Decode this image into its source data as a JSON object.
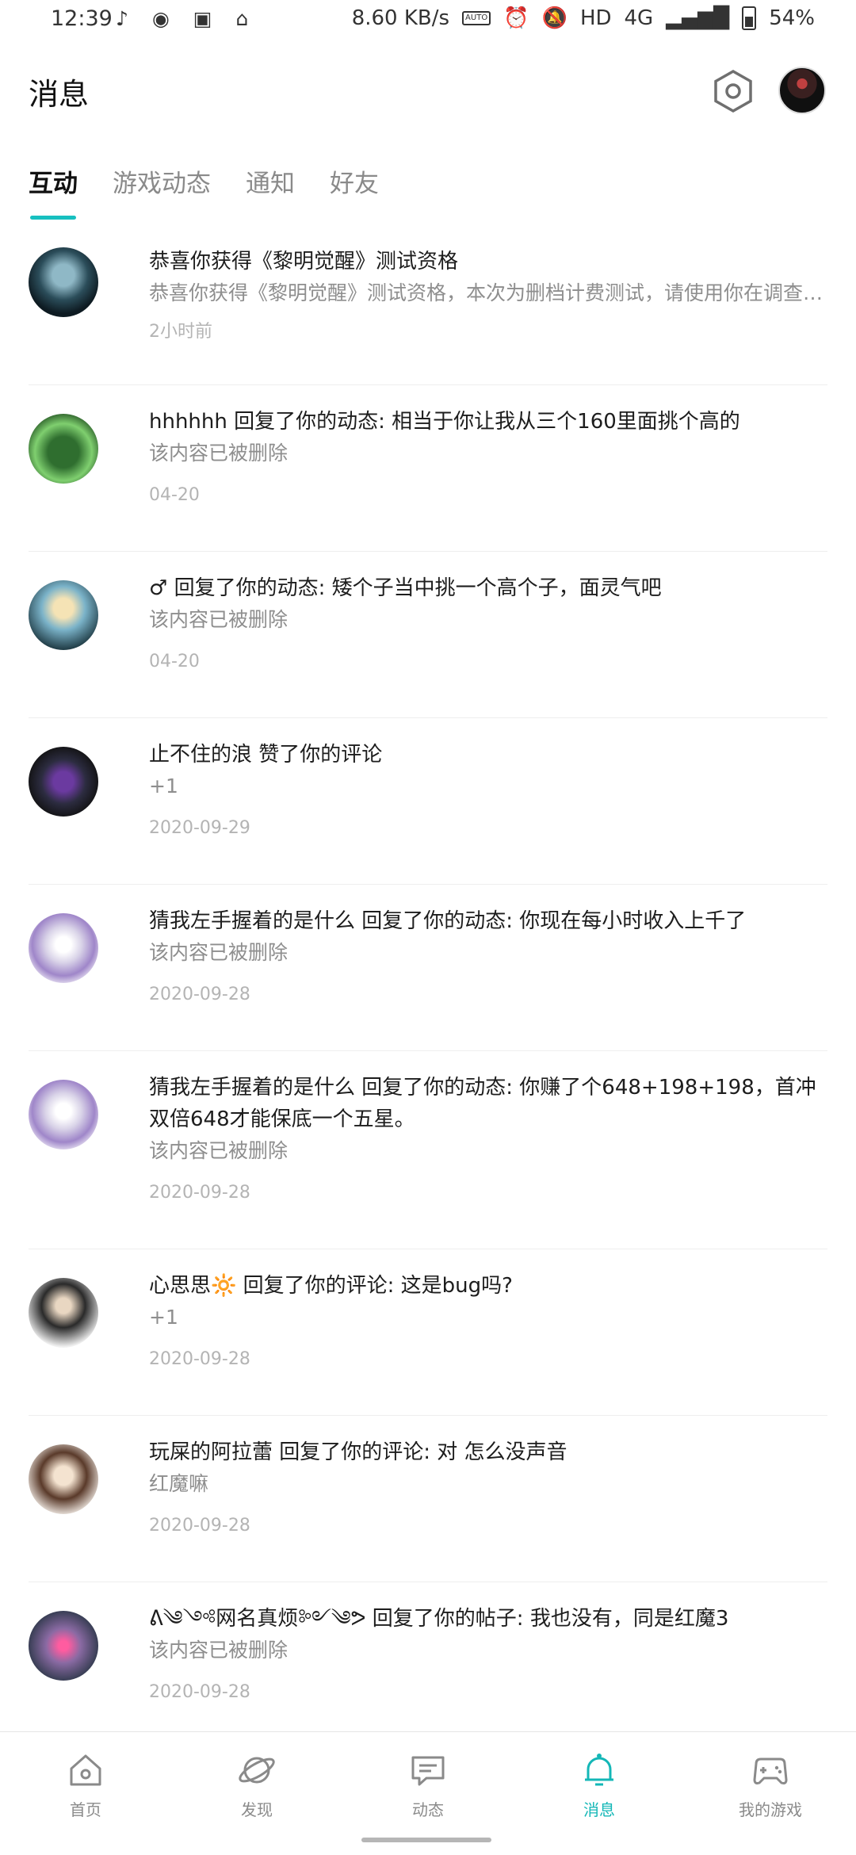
{
  "status_bar": {
    "time": "12:39",
    "network_speed": "8.60 KB/s",
    "badge_auto": "AUTO",
    "hd": "HD",
    "network_type": "4G",
    "battery": "54%"
  },
  "header": {
    "title": "消息",
    "settings_icon": "hexagon-settings-icon",
    "avatar_icon": "user-avatar"
  },
  "tabs": [
    {
      "label": "互动",
      "active": true
    },
    {
      "label": "游戏动态",
      "active": false
    },
    {
      "label": "通知",
      "active": false
    },
    {
      "label": "好友",
      "active": false
    }
  ],
  "messages": [
    {
      "title": "恭喜你获得《黎明觉醒》测试资格",
      "subtitle": "恭喜你获得《黎明觉醒》测试资格，本次为删档计费测试，请使用你在调查…",
      "time": "2小时前"
    },
    {
      "title": "hhhhhh 回复了你的动态: 相当于你让我从三个160里面挑个高的",
      "subtitle": "该内容已被删除",
      "time": "04-20"
    },
    {
      "title": "♂ 回复了你的动态: 矮个子当中挑一个高个子，面灵气吧",
      "subtitle": "该内容已被删除",
      "time": "04-20"
    },
    {
      "title": "止不住的浪 赞了你的评论",
      "subtitle": "+1",
      "time": "2020-09-29"
    },
    {
      "title": "猜我左手握着的是什么 回复了你的动态: 你现在每小时收入上千了",
      "subtitle": "该内容已被删除",
      "time": "2020-09-28"
    },
    {
      "title": "猜我左手握着的是什么 回复了你的动态: 你赚了个648+198+198，首冲双倍648才能保底一个五星。",
      "subtitle": "该内容已被删除",
      "time": "2020-09-28"
    },
    {
      "title": "心思思🔆 回复了你的评论: 这是bug吗?",
      "subtitle": "+1",
      "time": "2020-09-28"
    },
    {
      "title": "玩屎的阿拉蕾 回复了你的评论: 对 怎么没声音",
      "subtitle": "红魔嘛",
      "time": "2020-09-28"
    },
    {
      "title": "ᕕ༄༺网名真烦༻༄ᕗ 回复了你的帖子: 我也没有，同是红魔3",
      "subtitle": "该内容已被删除",
      "time": "2020-09-28"
    }
  ],
  "bottom_nav": [
    {
      "label": "首页",
      "icon": "home-icon",
      "active": false
    },
    {
      "label": "发现",
      "icon": "planet-icon",
      "active": false
    },
    {
      "label": "动态",
      "icon": "feed-icon",
      "active": false
    },
    {
      "label": "消息",
      "icon": "bell-icon",
      "active": true
    },
    {
      "label": "我的游戏",
      "icon": "gamepad-icon",
      "active": false
    }
  ],
  "accent_color": "#17c0c0"
}
